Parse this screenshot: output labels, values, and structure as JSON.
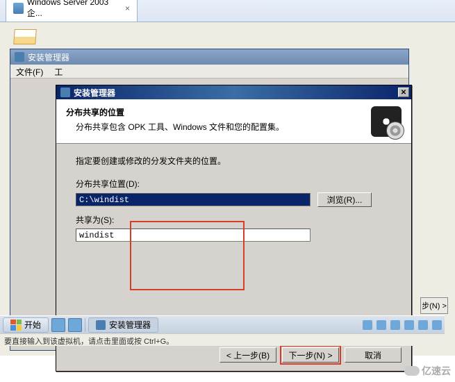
{
  "browser": {
    "tab_title": "Windows Server 2003 企..."
  },
  "parent_window": {
    "title": "安装管理器",
    "menu": {
      "file": "文件(F)",
      "tools": "工"
    }
  },
  "dialog": {
    "title": "安装管理器",
    "header_title": "分布共享的位置",
    "header_desc": "分布共享包含 OPK 工具、Windows 文件和您的配置集。",
    "instruction": "指定要创建或修改的分发文件夹的位置。",
    "field1_label": "分布共享位置(D):",
    "field1_value": "C:\\windist",
    "browse_label": "浏览(R)...",
    "field2_label": "共享为(S):",
    "field2_value": "windist",
    "buttons": {
      "back": "< 上一步(B)",
      "next": "下一步(N) >",
      "cancel": "取消"
    }
  },
  "hidden_button": "步(N) >",
  "taskbar": {
    "start": "开始",
    "task1": "安装管理器"
  },
  "statusbar": "要直接输入到该虚拟机，请点击里面或按 Ctrl+G。",
  "watermark": "亿速云"
}
